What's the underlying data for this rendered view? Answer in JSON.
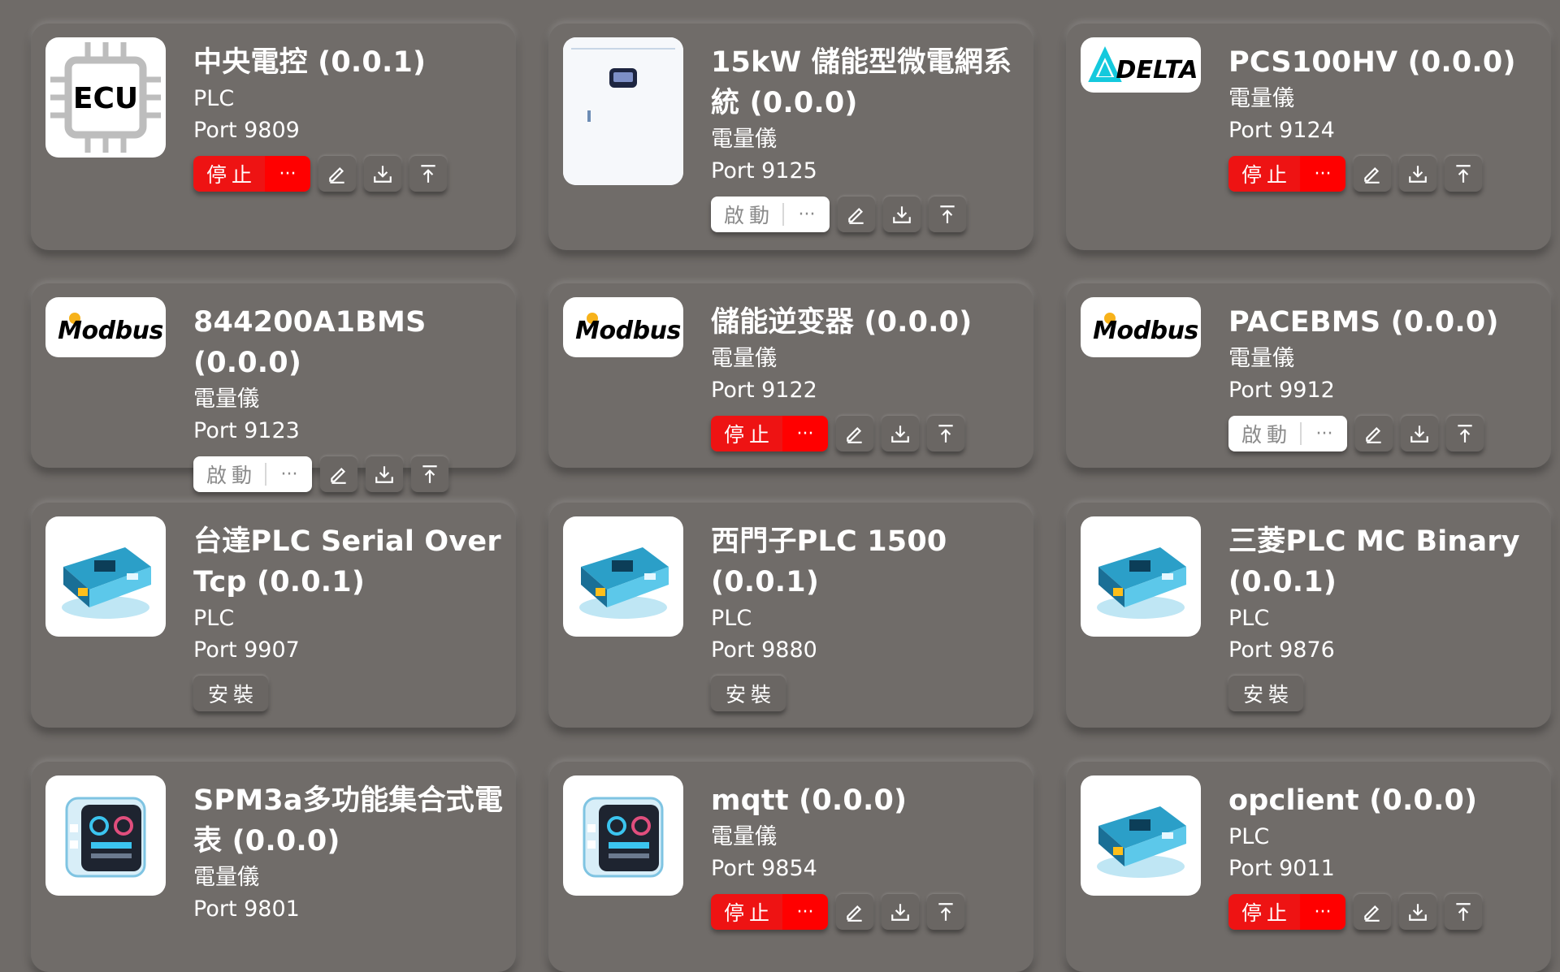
{
  "labels": {
    "stop": "停止",
    "start": "啟動",
    "more": "···",
    "install": "安裝"
  },
  "icons": {
    "edit": "edit-icon",
    "download": "download-icon",
    "upload": "upload-icon"
  },
  "colors": {
    "stop_red": "#ee1313",
    "background": "#6f6b68",
    "modbus_orange": "#f08a12",
    "delta_cyan": "#14c9dd",
    "ecu_cyan": "#1ed4f0"
  },
  "devices": [
    {
      "title": "中央電控 (0.0.1)",
      "type": "PLC",
      "port": "Port 9809",
      "status": "stop",
      "logo": "ECU",
      "logo_kind": "ecu"
    },
    {
      "title": "15kW 儲能型微電網系統 (0.0.0)",
      "type": "電量儀",
      "port": "Port 9125",
      "status": "start",
      "logo": "",
      "logo_kind": "cabinet"
    },
    {
      "title": "PCS100HV (0.0.0)",
      "type": "電量儀",
      "port": "Port 9124",
      "status": "stop",
      "logo": "DELTA",
      "logo_kind": "delta"
    },
    {
      "title": "844200A1BMS (0.0.0)",
      "type": "電量儀",
      "port": "Port 9123",
      "status": "start",
      "logo": "Modbus",
      "logo_kind": "modbus"
    },
    {
      "title": "儲能逆变器 (0.0.0)",
      "type": "電量儀",
      "port": "Port 9122",
      "status": "stop",
      "logo": "Modbus",
      "logo_kind": "modbus"
    },
    {
      "title": "PACEBMS (0.0.0)",
      "type": "電量儀",
      "port": "Port 9912",
      "status": "start",
      "logo": "Modbus",
      "logo_kind": "modbus"
    },
    {
      "title": "台達PLC Serial Over Tcp (0.0.1)",
      "type": "PLC",
      "port": "Port 9907",
      "status": "install",
      "logo": "",
      "logo_kind": "board"
    },
    {
      "title": "西門子PLC 1500 (0.0.1)",
      "type": "PLC",
      "port": "Port 9880",
      "status": "install",
      "logo": "",
      "logo_kind": "board"
    },
    {
      "title": "三菱PLC MC Binary (0.0.1)",
      "type": "PLC",
      "port": "Port 9876",
      "status": "install",
      "logo": "",
      "logo_kind": "board"
    },
    {
      "title": "SPM3a多功能集合式電表 (0.0.0)",
      "type": "電量儀",
      "port": "Port 9801",
      "status": "none",
      "logo": "",
      "logo_kind": "meter"
    },
    {
      "title": "mqtt (0.0.0)",
      "type": "電量儀",
      "port": "Port 9854",
      "status": "stop",
      "logo": "",
      "logo_kind": "meter"
    },
    {
      "title": "opclient (0.0.0)",
      "type": "PLC",
      "port": "Port 9011",
      "status": "stop",
      "logo": "",
      "logo_kind": "board"
    }
  ]
}
